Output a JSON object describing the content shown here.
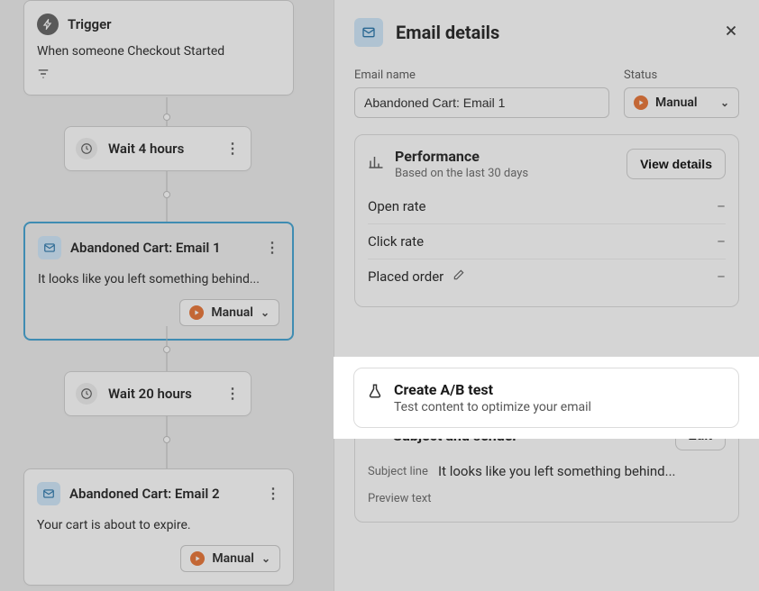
{
  "flow": {
    "trigger": {
      "title": "Trigger",
      "description": "When someone Checkout Started"
    },
    "wait1": {
      "label": "Wait 4 hours"
    },
    "email1": {
      "title": "Abandoned Cart: Email 1",
      "preview": "It looks like you left something behind...",
      "status_label": "Manual"
    },
    "wait2": {
      "label": "Wait 20 hours"
    },
    "email2": {
      "title": "Abandoned Cart: Email 2",
      "preview": "Your cart is about to expire.",
      "status_label": "Manual"
    }
  },
  "panel": {
    "title": "Email details",
    "email_name_label": "Email name",
    "email_name_value": "Abandoned Cart: Email 1",
    "status_label": "Status",
    "status_value": "Manual",
    "performance": {
      "title": "Performance",
      "subtitle": "Based on the last 30 days",
      "view_details": "View details",
      "metrics": {
        "open_rate_label": "Open rate",
        "open_rate_value": "–",
        "click_rate_label": "Click rate",
        "click_rate_value": "–",
        "placed_order_label": "Placed order",
        "placed_order_value": "–"
      }
    },
    "ab": {
      "title": "Create A/B test",
      "subtitle": "Test content to optimize your email"
    },
    "subject": {
      "section_title": "Subject and sender",
      "edit_label": "Edit",
      "subject_line_label": "Subject line",
      "subject_line_value": "It looks like you left something behind...",
      "preview_text_label": "Preview text"
    }
  }
}
